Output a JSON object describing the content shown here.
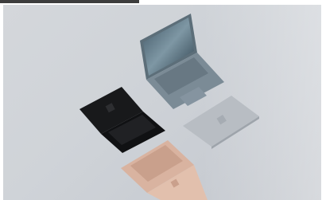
{
  "photo": {
    "subject": "four-laptops",
    "colors": {
      "background": "#cfd3d8",
      "black_laptop": "#17181a",
      "ice_blue_laptop": "#7d8c97",
      "platinum_laptop": "#b9bec4",
      "sandstone_laptop": "#d8b3a0"
    }
  }
}
